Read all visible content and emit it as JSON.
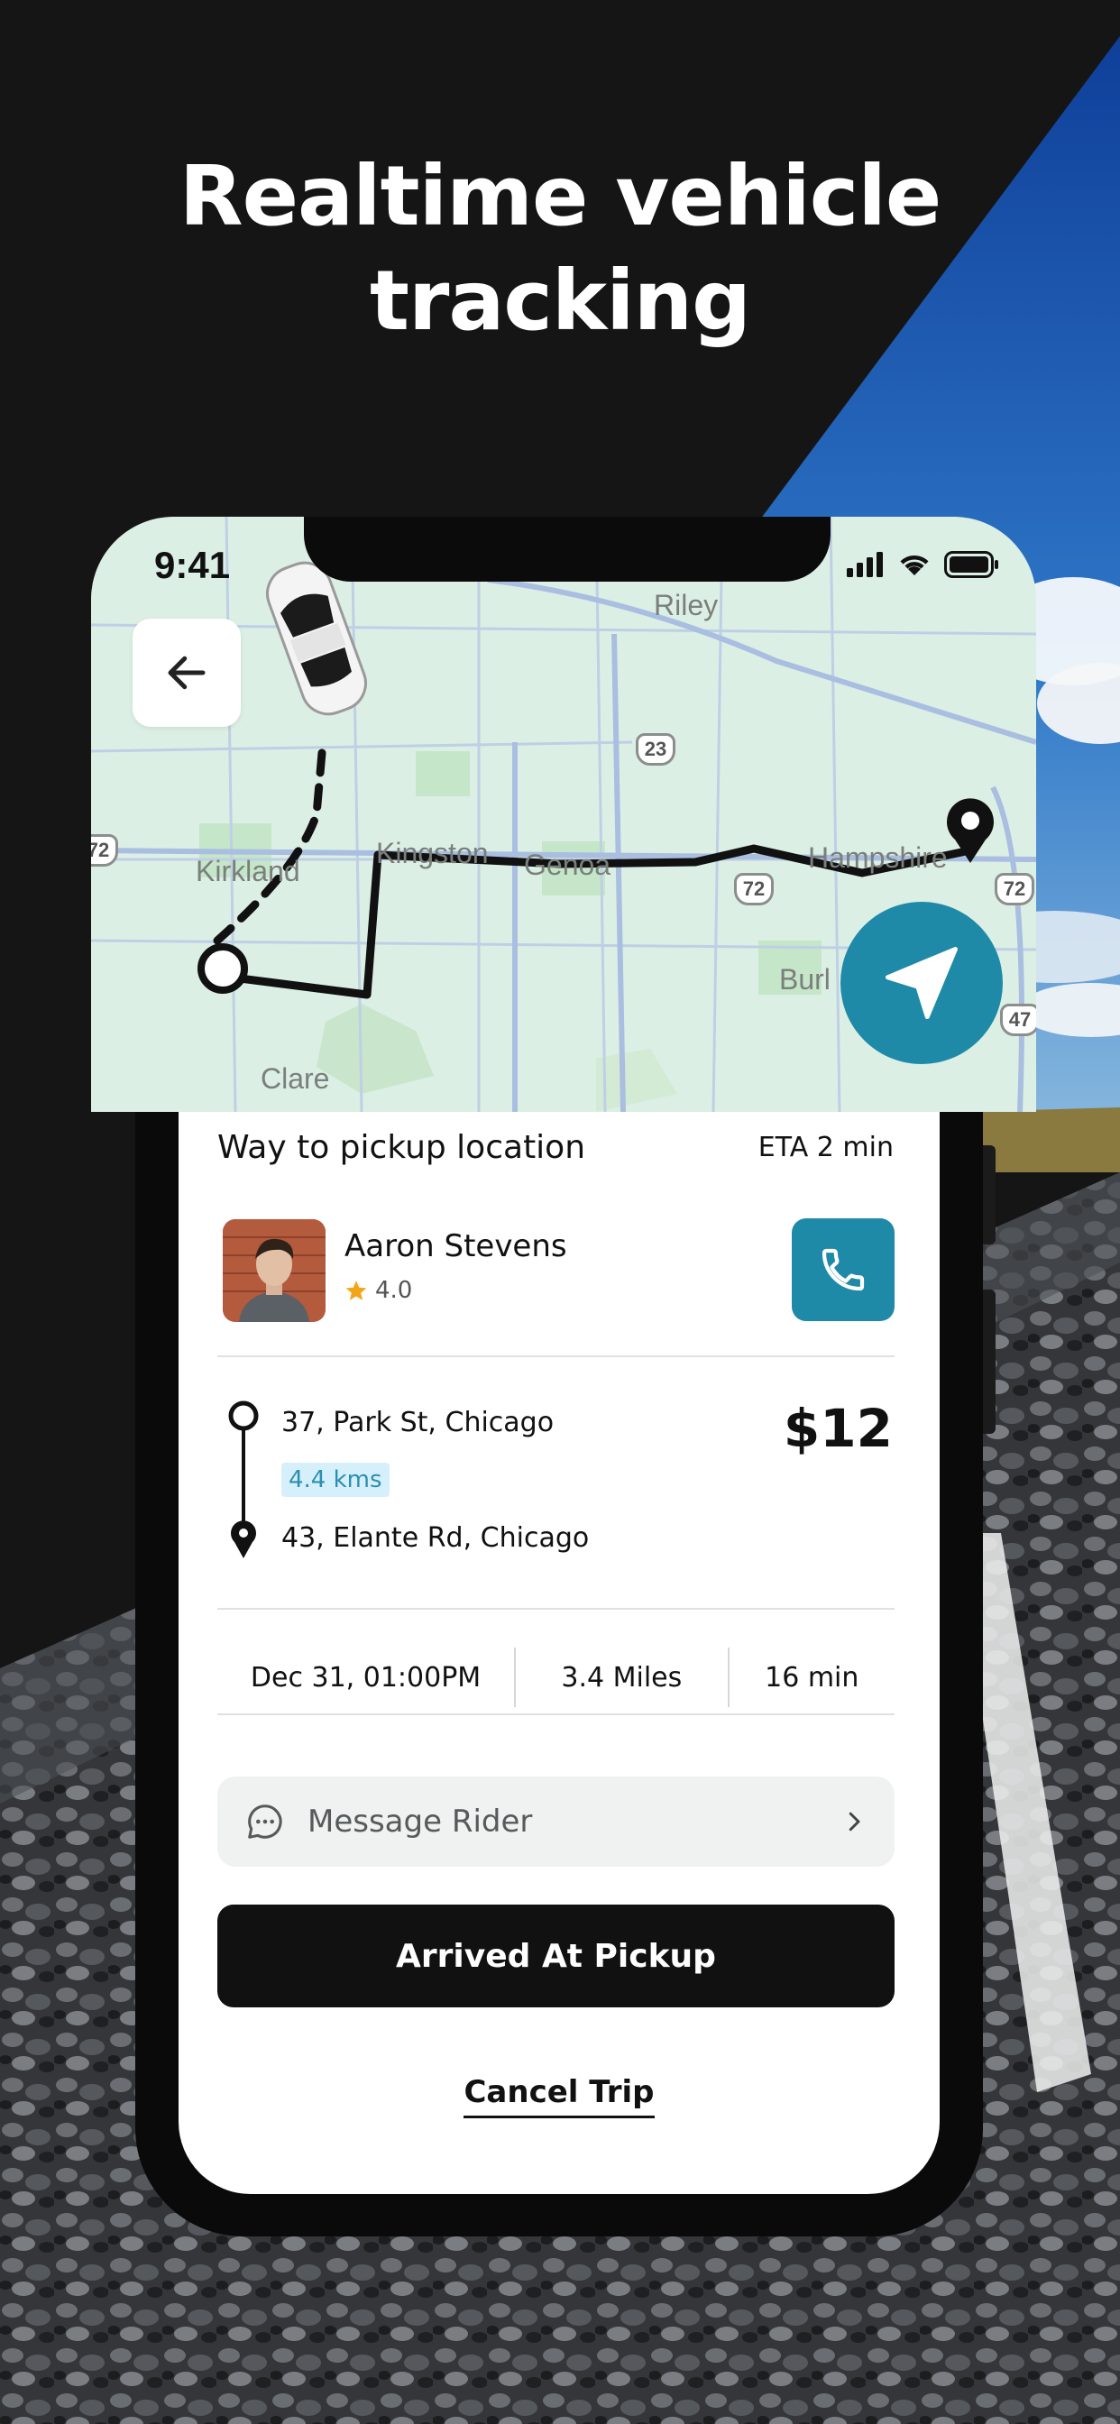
{
  "headline": {
    "line1": "Realtime vehicle",
    "line2": "tracking"
  },
  "status_bar": {
    "time": "9:41",
    "icons": [
      "signal-icon",
      "wifi-icon",
      "battery-icon"
    ]
  },
  "map": {
    "labels": [
      "Riley",
      "Kirkland",
      "Kingston",
      "Genoa",
      "Hampshire",
      "Burl",
      "Clare"
    ],
    "highway_shields": [
      "23",
      "72",
      "72",
      "72",
      "47"
    ],
    "icons": [
      "back-arrow-icon",
      "car-icon",
      "navigate-arrow-icon",
      "destination-pin-icon"
    ]
  },
  "trip": {
    "title": "Way to pickup location",
    "eta": "ETA 2 min",
    "rider": {
      "name": "Aaron Stevens",
      "rating": "4.0"
    },
    "pickup": "37, Park St, Chicago",
    "distance_badge": "4.4 kms",
    "dropoff": "43, Elante Rd, Chicago",
    "fare": "$12",
    "stats": {
      "datetime": "Dec 31, 01:00PM",
      "miles": "3.4 Miles",
      "duration": "16 min"
    },
    "message_label": "Message Rider",
    "primary_button": "Arrived At Pickup",
    "cancel_link": "Cancel Trip"
  },
  "colors": {
    "accent": "#1F8AA8",
    "dark": "#111111",
    "badge_bg": "#D6F0FB",
    "map_bg": "#DCEFE4"
  }
}
